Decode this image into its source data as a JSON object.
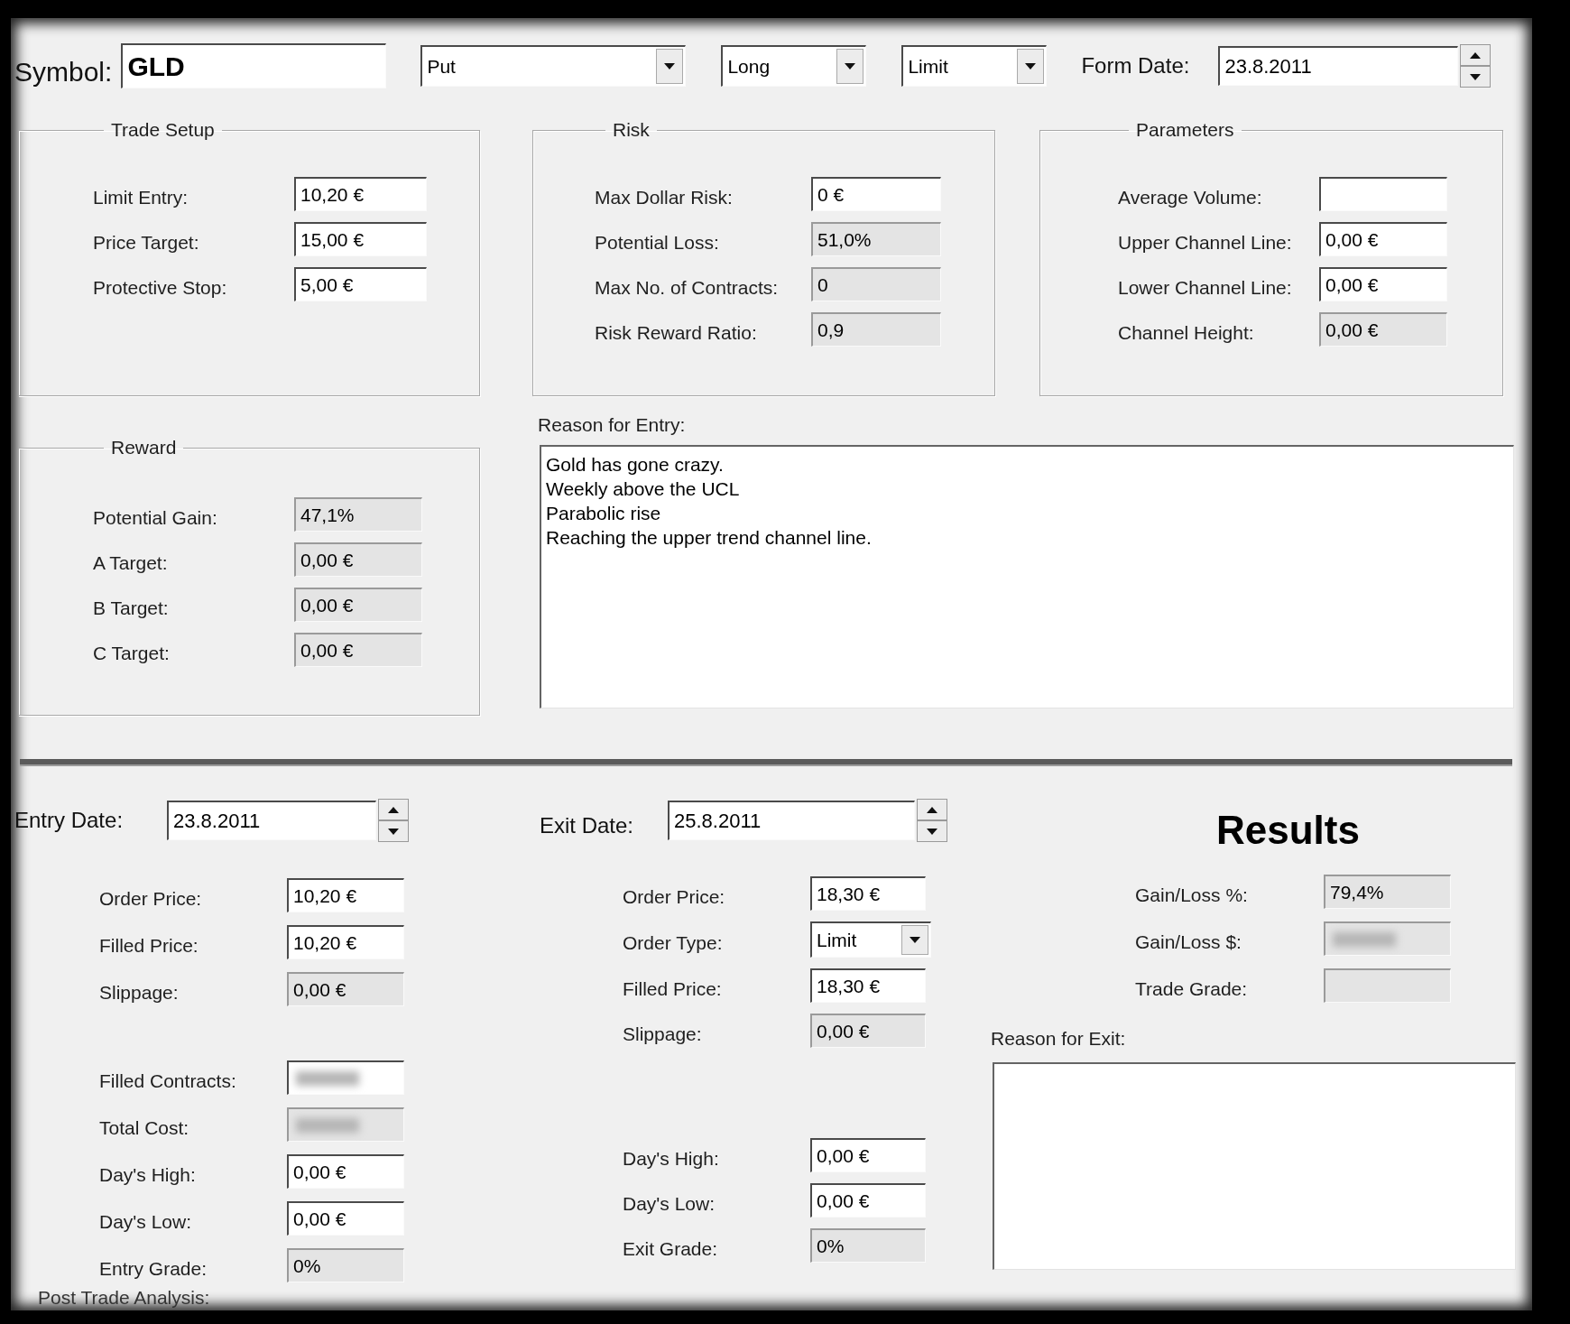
{
  "symbol": {
    "label": "Symbol:",
    "value": "GLD"
  },
  "selectors": [
    {
      "value": "Put"
    },
    {
      "value": "Long"
    },
    {
      "value": "Limit"
    }
  ],
  "form_date": {
    "label": "Form Date:",
    "value": "23.8.2011"
  },
  "groups": [
    {
      "title": "Trade Setup",
      "fields": [
        {
          "kind": "input",
          "label": "Limit Entry:",
          "value": "10,20 €",
          "readonly": false
        },
        {
          "kind": "input",
          "label": "Price Target:",
          "value": "15,00 €",
          "readonly": false
        },
        {
          "kind": "input",
          "label": "Protective Stop:",
          "value": "5,00 €",
          "readonly": false
        }
      ]
    },
    {
      "title": "Risk",
      "fields": [
        {
          "kind": "input",
          "label": "Max Dollar Risk:",
          "value": "0 €",
          "readonly": false
        },
        {
          "kind": "input",
          "label": "Potential Loss:",
          "value": "51,0%",
          "readonly": true
        },
        {
          "kind": "input",
          "label": "Max No. of Contracts:",
          "value": "0",
          "readonly": true
        },
        {
          "kind": "input",
          "label": "Risk Reward Ratio:",
          "value": "0,9",
          "readonly": true
        }
      ]
    },
    {
      "title": "Parameters",
      "fields": [
        {
          "kind": "input",
          "label": "Average Volume:",
          "readonly": false
        },
        {
          "kind": "input",
          "label": "Upper Channel Line:",
          "value": "0,00 €",
          "readonly": false
        },
        {
          "kind": "input",
          "label": "Lower Channel Line:",
          "value": "0,00 €",
          "readonly": false
        },
        {
          "kind": "input",
          "label": "Channel Height:",
          "value": "0,00 €",
          "readonly": true
        }
      ]
    },
    {
      "title": "Reward",
      "fields": [
        {
          "kind": "input",
          "label": "Potential Gain:",
          "value": "47,1%",
          "readonly": true
        },
        {
          "kind": "input",
          "label": "A Target:",
          "value": "0,00 €",
          "readonly": true
        },
        {
          "kind": "input",
          "label": "B Target:",
          "value": "0,00 €",
          "readonly": true
        },
        {
          "kind": "input",
          "label": "C Target:",
          "value": "0,00 €",
          "readonly": true
        }
      ]
    }
  ],
  "reason_for_entry": {
    "label": "Reason for Entry:",
    "value": "Gold has gone crazy.\nWeekly above the UCL\nParabolic rise\nReaching the upper trend channel line."
  },
  "entry": {
    "date_label": "Entry Date:",
    "date": "23.8.2011",
    "sections": [
      {
        "fields": [
          {
            "kind": "input",
            "label": "Order Price:",
            "value": "10,20 €",
            "readonly": false
          },
          {
            "kind": "input",
            "label": "Filled Price:",
            "value": "10,20 €",
            "readonly": false
          },
          {
            "kind": "input",
            "label": "Slippage:",
            "value": "0,00 €",
            "readonly": true
          }
        ]
      },
      {
        "fields": [
          {
            "kind": "blurred",
            "label": "Filled Contracts:",
            "readonly": false
          },
          {
            "kind": "blurred",
            "label": "Total Cost:",
            "readonly": true
          },
          {
            "kind": "input",
            "label": "Day's High:",
            "value": "0,00 €",
            "readonly": false
          },
          {
            "kind": "input",
            "label": "Day's Low:",
            "value": "0,00 €",
            "readonly": false
          },
          {
            "kind": "input",
            "label": "Entry Grade:",
            "value": "0%",
            "readonly": true
          }
        ]
      }
    ]
  },
  "exit": {
    "date_label": "Exit Date:",
    "date": "25.8.2011",
    "sections": [
      {
        "fields": [
          {
            "kind": "input",
            "label": "Order Price:",
            "value": "18,30 €",
            "readonly": false
          },
          {
            "kind": "combo",
            "label": "Order Type:",
            "value": "Limit",
            "readonly": false
          },
          {
            "kind": "input",
            "label": "Filled Price:",
            "value": "18,30 €",
            "readonly": false
          },
          {
            "kind": "input",
            "label": "Slippage:",
            "value": "0,00 €",
            "readonly": true
          }
        ]
      },
      {
        "fields": [
          {
            "kind": "input",
            "label": "Day's High:",
            "value": "0,00 €",
            "readonly": false
          },
          {
            "kind": "input",
            "label": "Day's Low:",
            "value": "0,00 €",
            "readonly": false
          },
          {
            "kind": "input",
            "label": "Exit Grade:",
            "value": "0%",
            "readonly": true
          }
        ]
      }
    ]
  },
  "results": {
    "title": "Results",
    "fields": [
      {
        "kind": "input",
        "label": "Gain/Loss %:",
        "value": "79,4%",
        "readonly": true
      },
      {
        "kind": "blurred",
        "label": "Gain/Loss $:",
        "readonly": true
      },
      {
        "kind": "input",
        "label": "Trade Grade:",
        "readonly": true
      }
    ]
  },
  "reason_for_exit": {
    "label": "Reason for Exit:"
  },
  "post_trade_analysis": {
    "label": "Post Trade Analysis:"
  }
}
